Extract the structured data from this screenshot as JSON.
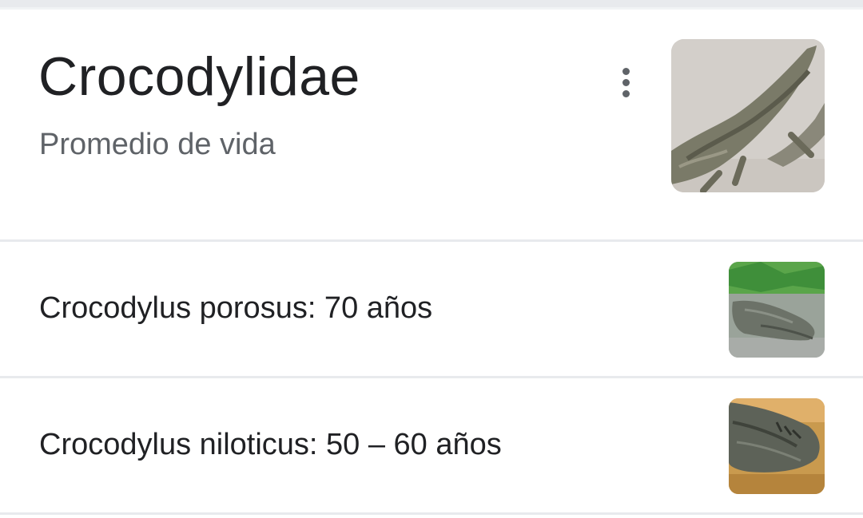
{
  "card": {
    "title": "Crocodylidae",
    "subtitle": "Promedio de vida",
    "menu_icon": "more-vert-icon",
    "image_icon": "crocodile-photo"
  },
  "items": [
    {
      "label": "Crocodylus porosus: 70 años",
      "image_icon": "saltwater-crocodile-photo"
    },
    {
      "label": "Crocodylus niloticus: 50 – 60 años",
      "image_icon": "nile-crocodile-photo"
    }
  ],
  "colors": {
    "title_text": "#202124",
    "secondary_text": "#5f6368",
    "divider": "#e8eaed",
    "background": "#ffffff"
  }
}
